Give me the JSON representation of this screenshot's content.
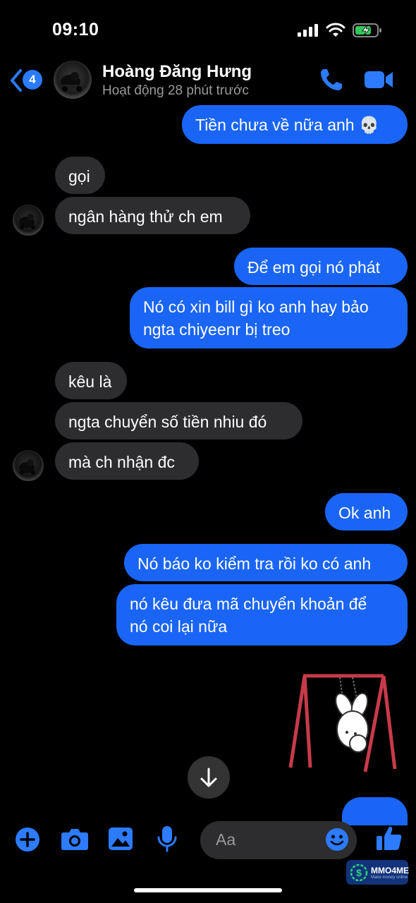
{
  "status_bar": {
    "time": "09:10"
  },
  "header": {
    "back_count": "4",
    "contact_name": "Hoàng Đăng Hưng",
    "contact_status": "Hoạt động 28 phút trước"
  },
  "messages": [
    {
      "side": "out",
      "text": "Tiền chưa về nữa anh 💀"
    },
    {
      "side": "in",
      "text": "gọi"
    },
    {
      "side": "in",
      "text": "ngân hàng thử ch em"
    },
    {
      "side": "out",
      "text": "Để em gọi nó phát"
    },
    {
      "side": "out",
      "lines": [
        "Nó có xin bill gì ko anh hay bảo",
        "ngta chiyeenr bị treo"
      ]
    },
    {
      "side": "in",
      "text": "kêu là"
    },
    {
      "side": "in",
      "text": "ngta chuyển số tiền nhiu đó"
    },
    {
      "side": "in",
      "text": "mà ch nhận đc"
    },
    {
      "side": "out",
      "text": "Ok anh"
    },
    {
      "side": "out",
      "text": "Nó báo ko kiểm tra rồi ko có anh"
    },
    {
      "side": "out",
      "lines": [
        "nó kêu đưa mã chuyển khoản để",
        "nó coi lại nữa"
      ]
    }
  ],
  "composer": {
    "placeholder": "Aa"
  },
  "watermark": {
    "label": "MMO4ME",
    "sub": "Make money online"
  },
  "colors": {
    "accent": "#1a65f5",
    "incoming_bubble": "#2d2d2f",
    "icon_blue": "#2d7bff",
    "background": "#000000"
  },
  "icons": [
    "back-chevron-icon",
    "phone-icon",
    "video-call-icon",
    "scroll-down-arrow-icon",
    "plus-icon",
    "camera-icon",
    "gallery-icon",
    "microphone-icon",
    "emoji-icon",
    "thumbs-up-icon",
    "skull-emoji-icon"
  ]
}
